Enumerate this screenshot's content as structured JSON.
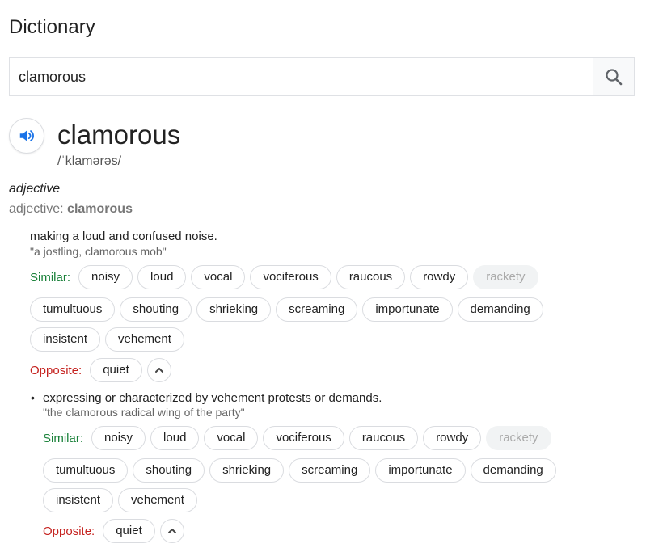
{
  "header": {
    "title": "Dictionary"
  },
  "search": {
    "value": "clamorous",
    "button_icon": "search-icon"
  },
  "entry": {
    "word": "clamorous",
    "phonetic": "/ˈklamərəs/",
    "part_of_speech": "adjective",
    "pos_label": "adjective: ",
    "pos_word": "clamorous"
  },
  "senses": [
    {
      "definition": "making a loud and confused noise.",
      "example": "\"a jostling, clamorous mob\"",
      "similar_label": "Similar:",
      "similar": [
        "noisy",
        "loud",
        "vocal",
        "vociferous",
        "raucous",
        "rowdy",
        "rackety",
        "tumultuous",
        "shouting",
        "shrieking",
        "screaming",
        "importunate",
        "demanding",
        "insistent",
        "vehement"
      ],
      "opposite_label": "Opposite:",
      "opposite": [
        "quiet"
      ]
    },
    {
      "definition": "expressing or characterized by vehement protests or demands.",
      "example": "\"the clamorous radical wing of the party\"",
      "similar_label": "Similar:",
      "similar": [
        "noisy",
        "loud",
        "vocal",
        "vociferous",
        "raucous",
        "rowdy",
        "rackety",
        "tumultuous",
        "shouting",
        "shrieking",
        "screaming",
        "importunate",
        "demanding",
        "insistent",
        "vehement"
      ],
      "opposite_label": "Opposite:",
      "opposite": [
        "quiet"
      ]
    }
  ],
  "colors": {
    "similar": "#188038",
    "opposite": "#c5221f",
    "accent": "#1a73e8"
  }
}
